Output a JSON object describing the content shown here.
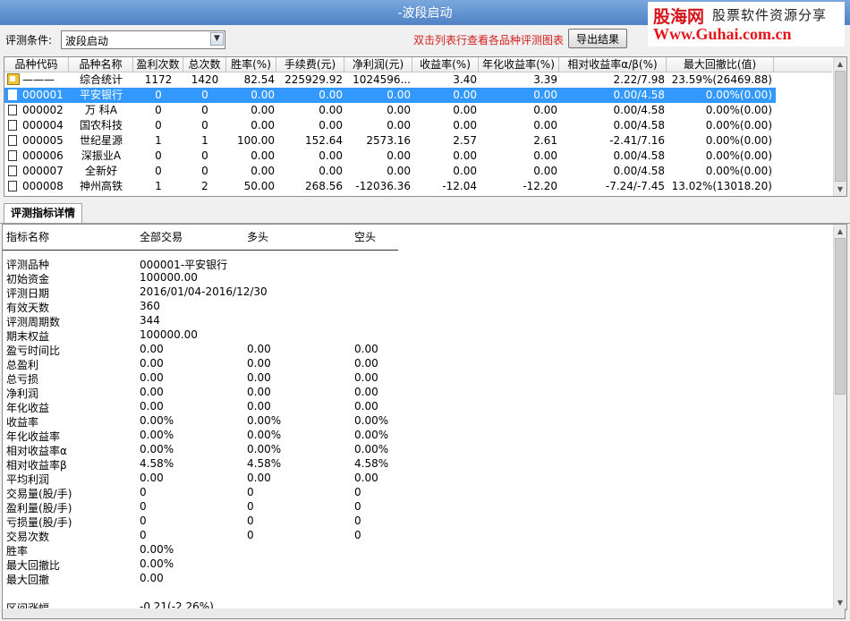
{
  "window": {
    "title": "-波段启动"
  },
  "logo": {
    "brand": "股海网",
    "slogan": "股票软件资源分享",
    "url": "Www.Guhai.com.cn"
  },
  "toolbar": {
    "condition_label": "评测条件:",
    "condition_value": "波段启动",
    "hint": "双击列表行查看各品种评测图表",
    "export_label": "导出结果"
  },
  "grid": {
    "columns": [
      "品种代码",
      "品种名称",
      "盈利次数",
      "总次数",
      "胜率(%)",
      "手续费(元)",
      "净利润(元)",
      "收益率(%)",
      "年化收益率(%)",
      "相对收益率α/β(%)",
      "最大回撤比(值)"
    ],
    "rows": [
      {
        "code": "———",
        "name": "综合统计",
        "wins": "1172",
        "total": "1420",
        "winrate": "82.54",
        "fee": "225929.92",
        "profit": "1024596...",
        "ret": "3.40",
        "annual": "3.39",
        "alpha": "2.22/7.98",
        "mdd": "23.59%(26469.88)",
        "summary": true
      },
      {
        "code": "000001",
        "name": "平安银行",
        "wins": "0",
        "total": "0",
        "winrate": "0.00",
        "fee": "0.00",
        "profit": "0.00",
        "ret": "0.00",
        "annual": "0.00",
        "alpha": "0.00/4.58",
        "mdd": "0.00%(0.00)",
        "selected": true
      },
      {
        "code": "000002",
        "name": "万  科A",
        "wins": "0",
        "total": "0",
        "winrate": "0.00",
        "fee": "0.00",
        "profit": "0.00",
        "ret": "0.00",
        "annual": "0.00",
        "alpha": "0.00/4.58",
        "mdd": "0.00%(0.00)"
      },
      {
        "code": "000004",
        "name": "国农科技",
        "wins": "0",
        "total": "0",
        "winrate": "0.00",
        "fee": "0.00",
        "profit": "0.00",
        "ret": "0.00",
        "annual": "0.00",
        "alpha": "0.00/4.58",
        "mdd": "0.00%(0.00)"
      },
      {
        "code": "000005",
        "name": "世纪星源",
        "wins": "1",
        "total": "1",
        "winrate": "100.00",
        "fee": "152.64",
        "profit": "2573.16",
        "ret": "2.57",
        "annual": "2.61",
        "alpha": "-2.41/7.16",
        "mdd": "0.00%(0.00)"
      },
      {
        "code": "000006",
        "name": "深振业A",
        "wins": "0",
        "total": "0",
        "winrate": "0.00",
        "fee": "0.00",
        "profit": "0.00",
        "ret": "0.00",
        "annual": "0.00",
        "alpha": "0.00/4.58",
        "mdd": "0.00%(0.00)"
      },
      {
        "code": "000007",
        "name": "全新好",
        "wins": "0",
        "total": "0",
        "winrate": "0.00",
        "fee": "0.00",
        "profit": "0.00",
        "ret": "0.00",
        "annual": "0.00",
        "alpha": "0.00/4.58",
        "mdd": "0.00%(0.00)"
      },
      {
        "code": "000008",
        "name": "神州高铁",
        "wins": "1",
        "total": "2",
        "winrate": "50.00",
        "fee": "268.56",
        "profit": "-12036.36",
        "ret": "-12.04",
        "annual": "-12.20",
        "alpha": "-7.24/-7.45",
        "mdd": "13.02%(13018.20)"
      }
    ]
  },
  "tab": {
    "label": "评测指标详情"
  },
  "detail": {
    "headers": [
      "指标名称",
      "全部交易",
      "多头",
      "空头"
    ],
    "rows": [
      [
        "评测品种",
        "000001-平安银行",
        "",
        ""
      ],
      [
        "初始资金",
        "100000.00",
        "",
        ""
      ],
      [
        "评测日期",
        "2016/01/04-2016/12/30",
        "",
        ""
      ],
      [
        "有效天数",
        "360",
        "",
        ""
      ],
      [
        "评测周期数",
        "344",
        "",
        ""
      ],
      [
        "期末权益",
        "100000.00",
        "",
        ""
      ],
      [
        "盈亏时间比",
        "0.00",
        "0.00",
        "0.00"
      ],
      [
        "总盈利",
        "0.00",
        "0.00",
        "0.00"
      ],
      [
        "总亏损",
        "0.00",
        "0.00",
        "0.00"
      ],
      [
        "净利润",
        "0.00",
        "0.00",
        "0.00"
      ],
      [
        "年化收益",
        "0.00",
        "0.00",
        "0.00"
      ],
      [
        "收益率",
        "0.00%",
        "0.00%",
        "0.00%"
      ],
      [
        "年化收益率",
        "0.00%",
        "0.00%",
        "0.00%"
      ],
      [
        "相对收益率α",
        "0.00%",
        "0.00%",
        "0.00%"
      ],
      [
        "相对收益率β",
        "4.58%",
        "4.58%",
        "4.58%"
      ],
      [
        "平均利润",
        "0.00",
        "0.00",
        "0.00"
      ],
      [
        "交易量(股/手)",
        "0",
        "0",
        "0"
      ],
      [
        "盈利量(股/手)",
        "0",
        "0",
        "0"
      ],
      [
        "亏损量(股/手)",
        "0",
        "0",
        "0"
      ],
      [
        "交易次数",
        "0",
        "0",
        "0"
      ],
      [
        "胜率",
        "0.00%",
        "",
        ""
      ],
      [
        "最大回撤比",
        "0.00%",
        "",
        ""
      ],
      [
        "最大回撤",
        "0.00",
        "",
        ""
      ],
      [
        "",
        "",
        " ",
        ""
      ],
      [
        "区间涨幅",
        "-0.21(-2.26%)",
        "",
        ""
      ]
    ]
  }
}
